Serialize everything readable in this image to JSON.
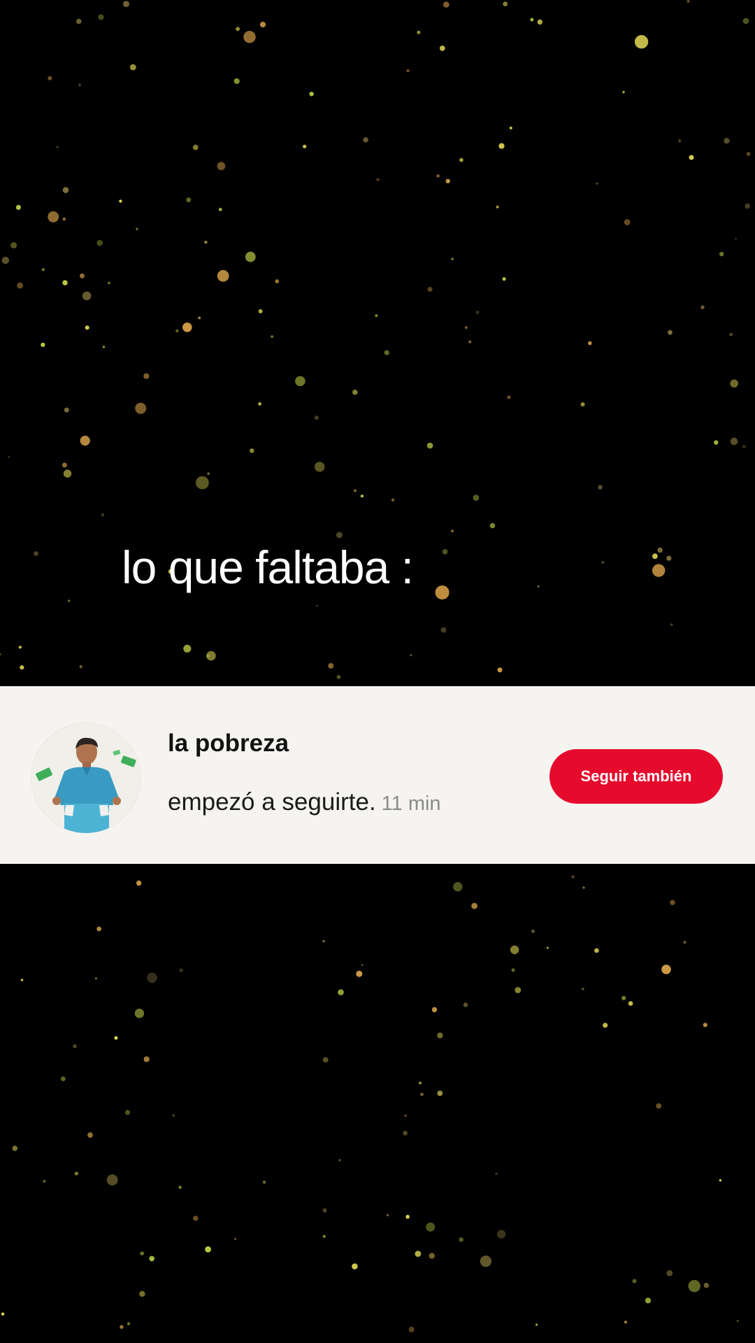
{
  "overlay": {
    "caption": "lo que faltaba :"
  },
  "notification": {
    "username": "la pobreza",
    "message": "empezó a seguirte.",
    "time": "11 min",
    "follow_button_label": "Seguir también",
    "avatar_icon": "person-empty-pockets-icon"
  },
  "colors": {
    "background": "#000000",
    "card": "#f6f4f1",
    "button": "#e60a2d",
    "particles": [
      "#f2e85a",
      "#d9a24a",
      "#c9d84a",
      "#8a7a40"
    ]
  }
}
